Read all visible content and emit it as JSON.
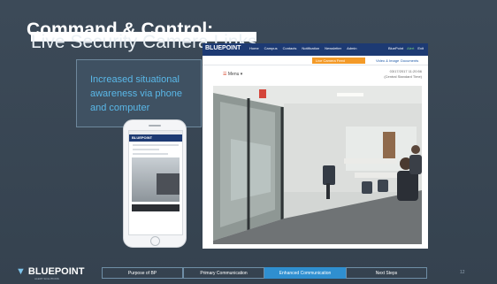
{
  "slide": {
    "title_bold": "Command & Control:",
    "title_light": "Live Security Camera Links",
    "callout": "Increased situational awareness via phone and computer",
    "page_number": "12"
  },
  "phone": {
    "logo": "BLUEPOINT"
  },
  "app": {
    "logo": "BLUEPOINT",
    "nav": [
      "Home",
      "Campus",
      "Contacts",
      "Notification",
      "Newsletter",
      "Admin"
    ],
    "nav_right": [
      "BluePoint",
      "Alert",
      "Exit"
    ],
    "alert_button": "Live Camera Feed",
    "tab_video": "Video & Image",
    "tab_documents": "Documents",
    "menu": "Menu",
    "timestamp_date": "03/17/2017 11:20:56",
    "timestamp_zone": "(Central Standard Time)"
  },
  "footer": {
    "logo": "BLUEPOINT",
    "tagline": "ALERT SOLUTIONS",
    "crumbs": [
      "Purpose of BP",
      "Primary Communication",
      "Enhanced Communication",
      "Next Steps"
    ],
    "active_crumb": 2
  },
  "colors": {
    "background": "#3b4957",
    "accent": "#2f8fd0",
    "nav": "#1d3a73",
    "alert": "#f39a28",
    "callout_text": "#5ab8e8"
  }
}
